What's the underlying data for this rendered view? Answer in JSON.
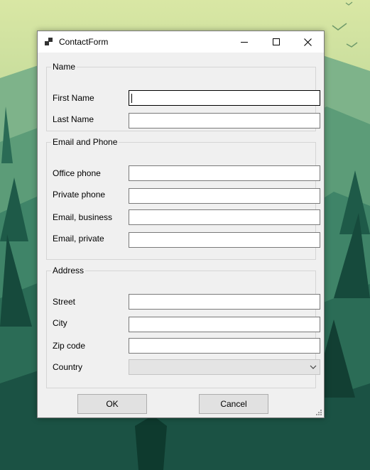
{
  "window": {
    "title": "ContactForm"
  },
  "name_group": {
    "legend": "Name",
    "first_name_label": "First Name",
    "first_name_value": "",
    "last_name_label": "Last Name",
    "last_name_value": ""
  },
  "contact_group": {
    "legend": "Email and Phone",
    "office_phone_label": "Office phone",
    "office_phone_value": "",
    "private_phone_label": "Private phone",
    "private_phone_value": "",
    "email_business_label": "Email, business",
    "email_business_value": "",
    "email_private_label": "Email, private",
    "email_private_value": ""
  },
  "address_group": {
    "legend": "Address",
    "street_label": "Street",
    "street_value": "",
    "city_label": "City",
    "city_value": "",
    "zip_label": "Zip code",
    "zip_value": "",
    "country_label": "Country",
    "country_value": ""
  },
  "buttons": {
    "ok": "OK",
    "cancel": "Cancel"
  },
  "icons": {
    "app": "app-icon",
    "minimize": "minimize-icon",
    "maximize": "maximize-icon",
    "close": "close-icon",
    "dropdown": "chevron-down-icon",
    "resize": "resize-grip-icon"
  }
}
